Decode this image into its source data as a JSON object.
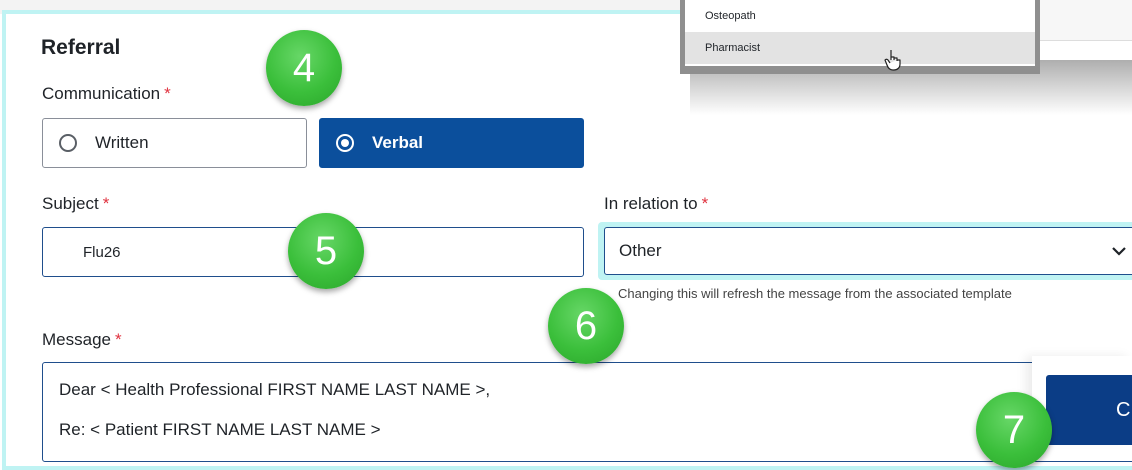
{
  "referral": {
    "title": "Referral",
    "communication": {
      "label": "Communication",
      "required": "*",
      "options": [
        "Written",
        "Verbal"
      ],
      "selected": "Verbal"
    },
    "subject": {
      "label": "Subject",
      "required": "*",
      "value": "Flu26"
    },
    "relation": {
      "label": "In relation to",
      "required": "*",
      "value": "Other",
      "hint": "Changing this will refresh the message from the associated template"
    },
    "message": {
      "label": "Message",
      "required": "*",
      "lines": [
        "Dear < Health Professional FIRST NAME LAST NAME >,",
        "Re: < Patient FIRST NAME LAST NAME >"
      ]
    }
  },
  "dropdown": {
    "items": [
      "Osteopath",
      "Pharmacist"
    ],
    "hovered": "Pharmacist"
  },
  "continue_button": {
    "label_partial": "C"
  },
  "badges": [
    "4",
    "5",
    "6",
    "7"
  ],
  "colors": {
    "primary": "#0b4f9c",
    "badge": "#3bbf3b",
    "required": "#e0323f",
    "focus_ring": "#bff3f3"
  }
}
